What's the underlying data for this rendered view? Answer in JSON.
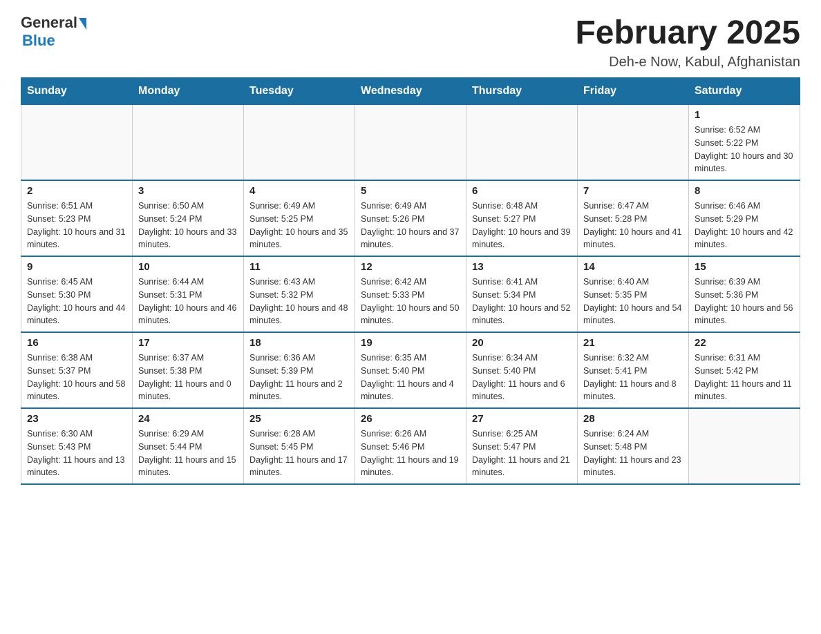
{
  "header": {
    "logo_general": "General",
    "logo_blue": "Blue",
    "month_title": "February 2025",
    "location": "Deh-e Now, Kabul, Afghanistan"
  },
  "days_of_week": [
    "Sunday",
    "Monday",
    "Tuesday",
    "Wednesday",
    "Thursday",
    "Friday",
    "Saturday"
  ],
  "weeks": [
    [
      {
        "day": "",
        "info": ""
      },
      {
        "day": "",
        "info": ""
      },
      {
        "day": "",
        "info": ""
      },
      {
        "day": "",
        "info": ""
      },
      {
        "day": "",
        "info": ""
      },
      {
        "day": "",
        "info": ""
      },
      {
        "day": "1",
        "info": "Sunrise: 6:52 AM\nSunset: 5:22 PM\nDaylight: 10 hours and 30 minutes."
      }
    ],
    [
      {
        "day": "2",
        "info": "Sunrise: 6:51 AM\nSunset: 5:23 PM\nDaylight: 10 hours and 31 minutes."
      },
      {
        "day": "3",
        "info": "Sunrise: 6:50 AM\nSunset: 5:24 PM\nDaylight: 10 hours and 33 minutes."
      },
      {
        "day": "4",
        "info": "Sunrise: 6:49 AM\nSunset: 5:25 PM\nDaylight: 10 hours and 35 minutes."
      },
      {
        "day": "5",
        "info": "Sunrise: 6:49 AM\nSunset: 5:26 PM\nDaylight: 10 hours and 37 minutes."
      },
      {
        "day": "6",
        "info": "Sunrise: 6:48 AM\nSunset: 5:27 PM\nDaylight: 10 hours and 39 minutes."
      },
      {
        "day": "7",
        "info": "Sunrise: 6:47 AM\nSunset: 5:28 PM\nDaylight: 10 hours and 41 minutes."
      },
      {
        "day": "8",
        "info": "Sunrise: 6:46 AM\nSunset: 5:29 PM\nDaylight: 10 hours and 42 minutes."
      }
    ],
    [
      {
        "day": "9",
        "info": "Sunrise: 6:45 AM\nSunset: 5:30 PM\nDaylight: 10 hours and 44 minutes."
      },
      {
        "day": "10",
        "info": "Sunrise: 6:44 AM\nSunset: 5:31 PM\nDaylight: 10 hours and 46 minutes."
      },
      {
        "day": "11",
        "info": "Sunrise: 6:43 AM\nSunset: 5:32 PM\nDaylight: 10 hours and 48 minutes."
      },
      {
        "day": "12",
        "info": "Sunrise: 6:42 AM\nSunset: 5:33 PM\nDaylight: 10 hours and 50 minutes."
      },
      {
        "day": "13",
        "info": "Sunrise: 6:41 AM\nSunset: 5:34 PM\nDaylight: 10 hours and 52 minutes."
      },
      {
        "day": "14",
        "info": "Sunrise: 6:40 AM\nSunset: 5:35 PM\nDaylight: 10 hours and 54 minutes."
      },
      {
        "day": "15",
        "info": "Sunrise: 6:39 AM\nSunset: 5:36 PM\nDaylight: 10 hours and 56 minutes."
      }
    ],
    [
      {
        "day": "16",
        "info": "Sunrise: 6:38 AM\nSunset: 5:37 PM\nDaylight: 10 hours and 58 minutes."
      },
      {
        "day": "17",
        "info": "Sunrise: 6:37 AM\nSunset: 5:38 PM\nDaylight: 11 hours and 0 minutes."
      },
      {
        "day": "18",
        "info": "Sunrise: 6:36 AM\nSunset: 5:39 PM\nDaylight: 11 hours and 2 minutes."
      },
      {
        "day": "19",
        "info": "Sunrise: 6:35 AM\nSunset: 5:40 PM\nDaylight: 11 hours and 4 minutes."
      },
      {
        "day": "20",
        "info": "Sunrise: 6:34 AM\nSunset: 5:40 PM\nDaylight: 11 hours and 6 minutes."
      },
      {
        "day": "21",
        "info": "Sunrise: 6:32 AM\nSunset: 5:41 PM\nDaylight: 11 hours and 8 minutes."
      },
      {
        "day": "22",
        "info": "Sunrise: 6:31 AM\nSunset: 5:42 PM\nDaylight: 11 hours and 11 minutes."
      }
    ],
    [
      {
        "day": "23",
        "info": "Sunrise: 6:30 AM\nSunset: 5:43 PM\nDaylight: 11 hours and 13 minutes."
      },
      {
        "day": "24",
        "info": "Sunrise: 6:29 AM\nSunset: 5:44 PM\nDaylight: 11 hours and 15 minutes."
      },
      {
        "day": "25",
        "info": "Sunrise: 6:28 AM\nSunset: 5:45 PM\nDaylight: 11 hours and 17 minutes."
      },
      {
        "day": "26",
        "info": "Sunrise: 6:26 AM\nSunset: 5:46 PM\nDaylight: 11 hours and 19 minutes."
      },
      {
        "day": "27",
        "info": "Sunrise: 6:25 AM\nSunset: 5:47 PM\nDaylight: 11 hours and 21 minutes."
      },
      {
        "day": "28",
        "info": "Sunrise: 6:24 AM\nSunset: 5:48 PM\nDaylight: 11 hours and 23 minutes."
      },
      {
        "day": "",
        "info": ""
      }
    ]
  ]
}
